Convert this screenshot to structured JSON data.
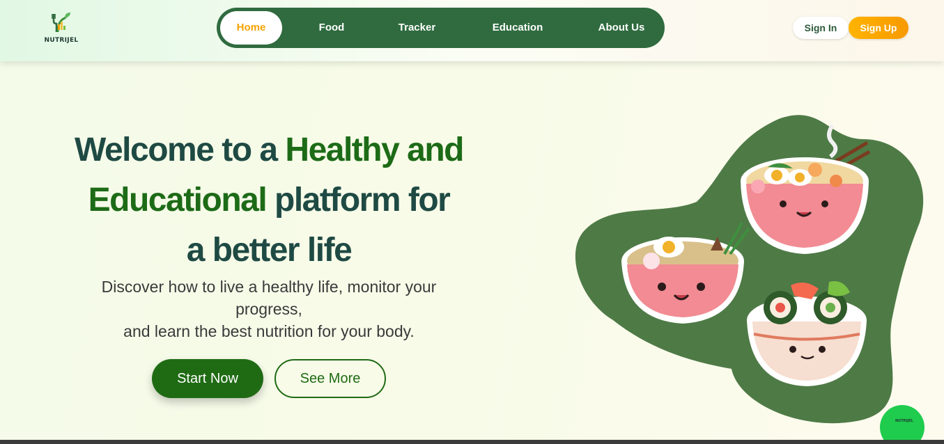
{
  "brand": {
    "name": "NUTRIJEL"
  },
  "nav": {
    "items": [
      {
        "label": "Home",
        "active": true
      },
      {
        "label": "Food"
      },
      {
        "label": "Tracker"
      },
      {
        "label": "Education"
      },
      {
        "label": "About Us"
      }
    ]
  },
  "auth": {
    "signin_label": "Sign In",
    "signup_label": "Sign Up"
  },
  "hero": {
    "title_part1": "Welcome to a ",
    "title_highlight1": "Healthy and",
    "title_highlight2": "Educational",
    "title_part2": " platform for",
    "title_part3": "a better life",
    "desc_line1": "Discover how to live a healthy life, monitor your",
    "desc_line2": "progress,",
    "desc_line3": "and learn the best nutrition for your body.",
    "start_label": "Start Now",
    "more_label": "See More"
  },
  "floating": {
    "label": "NUTRIJEL"
  },
  "colors": {
    "nav_bg": "#2f6b3f",
    "accent_orange": "#f5a300",
    "accent_green": "#1f6b14",
    "title_dark": "#1f4a44",
    "floating_green": "#1fcc4e"
  }
}
